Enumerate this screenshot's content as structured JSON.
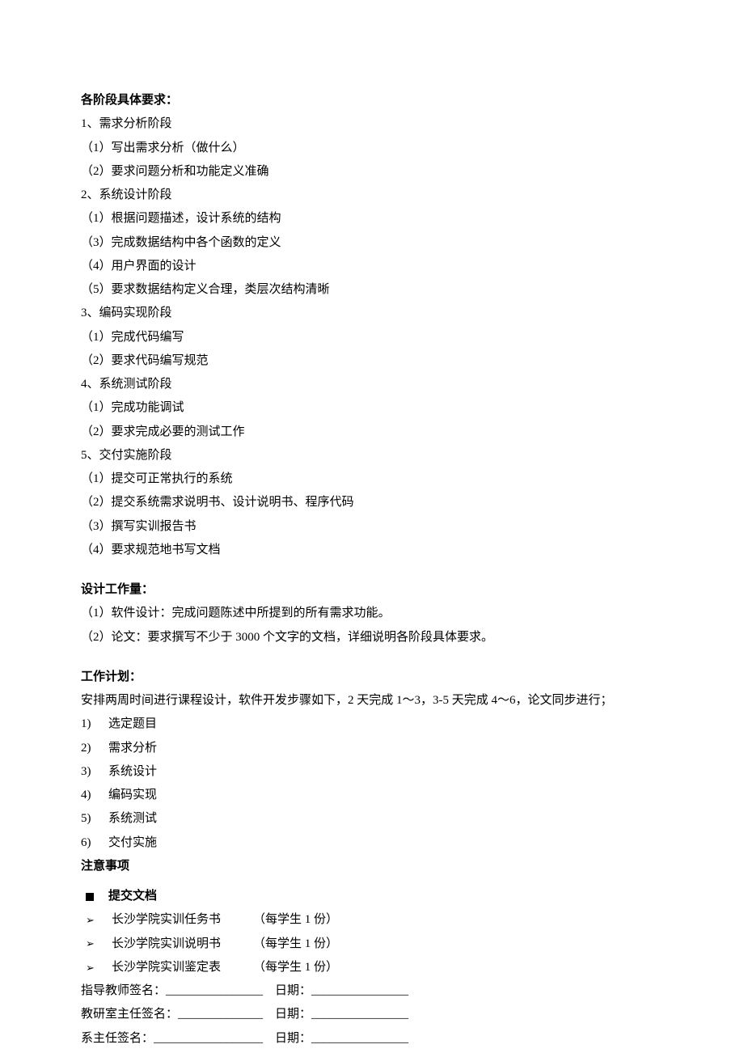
{
  "section1": {
    "title": "各阶段具体要求：",
    "phases": [
      {
        "heading": "1、需求分析阶段",
        "items": [
          "（1）写出需求分析（做什么）",
          "（2）要求问题分析和功能定义准确"
        ]
      },
      {
        "heading": "2、系统设计阶段",
        "items": [
          "（1）根据问题描述，设计系统的结构",
          "（3）完成数据结构中各个函数的定义",
          "（4）用户界面的设计",
          "（5）要求数据结构定义合理，类层次结构清晰"
        ]
      },
      {
        "heading": "3、编码实现阶段",
        "items": [
          "（1）完成代码编写",
          "（2）要求代码编写规范"
        ]
      },
      {
        "heading": "4、系统测试阶段",
        "items": [
          "（1）完成功能调试",
          "（2）要求完成必要的测试工作"
        ]
      },
      {
        "heading": "5、交付实施阶段",
        "items": [
          "（1）提交可正常执行的系统",
          "（2）提交系统需求说明书、设计说明书、程序代码",
          "（3）撰写实训报告书",
          "（4）要求规范地书写文档"
        ]
      }
    ]
  },
  "section2": {
    "title": "设计工作量：",
    "items": [
      "（1）软件设计：完成问题陈述中所提到的所有需求功能。",
      "（2）论文：要求撰写不少于 3000 个文字的文档，详细说明各阶段具体要求。"
    ]
  },
  "section3": {
    "title": "工作计划：",
    "intro": "安排两周时间进行课程设计，软件开发步骤如下，2 天完成 1～3，3-5 天完成 4～6，论文同步进行；",
    "steps": [
      {
        "n": "1)",
        "t": "选定题目"
      },
      {
        "n": "2)",
        "t": "需求分析"
      },
      {
        "n": "3)",
        "t": "系统设计"
      },
      {
        "n": "4)",
        "t": "编码实现"
      },
      {
        "n": "5)",
        "t": "系统测试"
      },
      {
        "n": "6)",
        "t": "交付实施"
      }
    ]
  },
  "section4": {
    "title": "注意事项",
    "submit_heading": "提交文档",
    "docs": [
      {
        "name": "长沙学院实训任务书",
        "qty": "（每学生 1 份）"
      },
      {
        "name": "长沙学院实训说明书",
        "qty": "（每学生 1 份）"
      },
      {
        "name": "长沙学院实训鉴定表",
        "qty": "（每学生 1 份）"
      }
    ],
    "sig1": "指导教师签名：________________    日期：________________",
    "sig2": "教研室主任签名：______________    日期：________________",
    "sig3": "系主任签名：__________________    日期：________________"
  }
}
